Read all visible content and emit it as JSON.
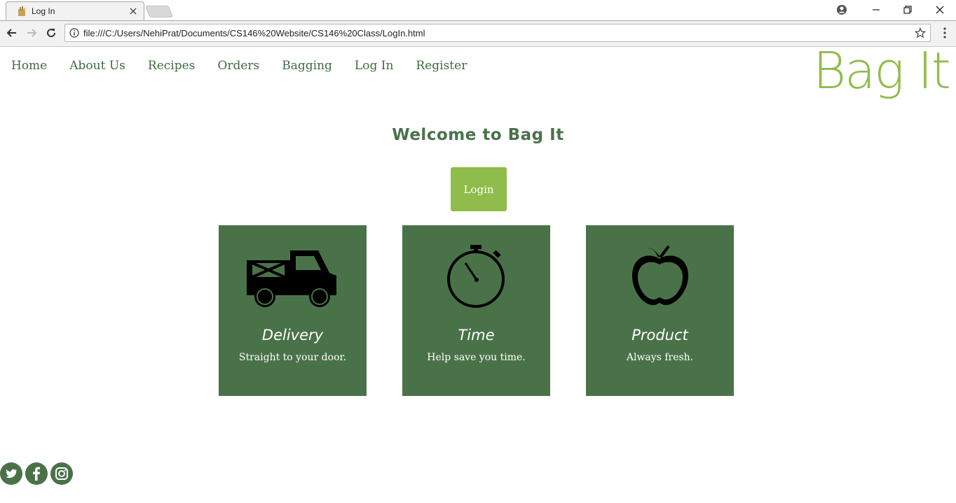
{
  "browser": {
    "tab_title": "Log In",
    "url": "file:///C:/Users/NehiPrat/Documents/CS146%20Website/CS146%20Class/LogIn.html"
  },
  "nav": {
    "items": [
      "Home",
      "About Us",
      "Recipes",
      "Orders",
      "Bagging",
      "Log In",
      "Register"
    ]
  },
  "logo": {
    "text": "Bag It"
  },
  "main": {
    "heading": "Welcome to Bag It",
    "login_label": "Login"
  },
  "cards": [
    {
      "icon": "truck-icon",
      "title": "Delivery",
      "desc": "Straight to your door."
    },
    {
      "icon": "stopwatch-icon",
      "title": "Time",
      "desc": "Help save you time."
    },
    {
      "icon": "apple-icon",
      "title": "Product",
      "desc": "Always fresh."
    }
  ],
  "social": [
    "twitter-icon",
    "facebook-icon",
    "instagram-icon"
  ],
  "colors": {
    "dark_green": "#4a7249",
    "light_green": "#8fbc4a",
    "nav_text": "#3e6b3e"
  }
}
